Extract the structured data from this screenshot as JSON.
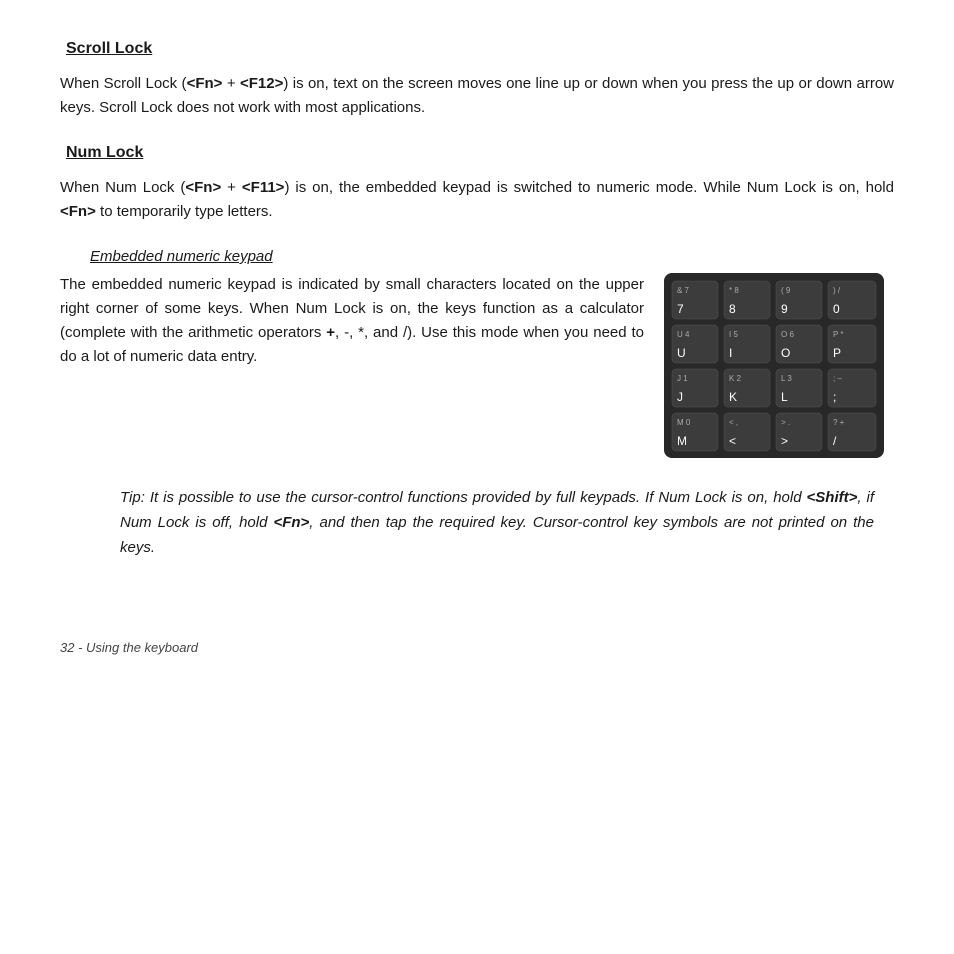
{
  "scroll_lock": {
    "heading": "Scroll Lock",
    "paragraph": "When Scroll Lock (<Fn> + <F12>) is on, text on the screen moves one line up or down when you press the up or down arrow keys. Scroll Lock does not work with most applications."
  },
  "num_lock": {
    "heading": "Num Lock",
    "paragraph": "When Num Lock (<Fn> + <F11>) is on, the embedded keypad is switched to numeric mode. While Num Lock is on, hold <Fn> to temporarily type letters."
  },
  "embedded": {
    "subheading": "Embedded numeric keypad",
    "paragraph": "The embedded numeric keypad is indicated by small characters located on the upper right corner of some keys. When Num Lock is on, the keys function as a calculator (complete with the arithmetic operators +, -, *, and /). Use this mode when you need to do a lot of numeric data entry."
  },
  "tip": {
    "text": "Tip: It is possible to use the cursor-control functions provided by full keypads. If Num Lock is on, hold <Shift>, if Num Lock is off, hold <Fn>, and then tap the required key. Cursor-control key symbols are not printed on the keys."
  },
  "footer": {
    "text": "32 - Using the keyboard"
  },
  "keypad_rows": [
    [
      {
        "sub": "& 7",
        "main": "7"
      },
      {
        "sub": "* 8",
        "main": "8"
      },
      {
        "sub": "( 9",
        "main": "9"
      },
      {
        "sub": ") /",
        "main": "0"
      }
    ],
    [
      {
        "sub": "U 4",
        "main": "U"
      },
      {
        "sub": "I 5",
        "main": "I"
      },
      {
        "sub": "O 6",
        "main": "O"
      },
      {
        "sub": "P *",
        "main": "P"
      }
    ],
    [
      {
        "sub": "J 1",
        "main": "J"
      },
      {
        "sub": "K 2",
        "main": "K"
      },
      {
        "sub": "L 3",
        "main": "L"
      },
      {
        "sub": "; –",
        "main": ";"
      }
    ],
    [
      {
        "sub": "M 0",
        "main": "M"
      },
      {
        "sub": "< ,",
        "main": "<"
      },
      {
        "sub": "> .",
        "main": ">"
      },
      {
        "sub": "? +",
        "main": "/"
      }
    ]
  ]
}
